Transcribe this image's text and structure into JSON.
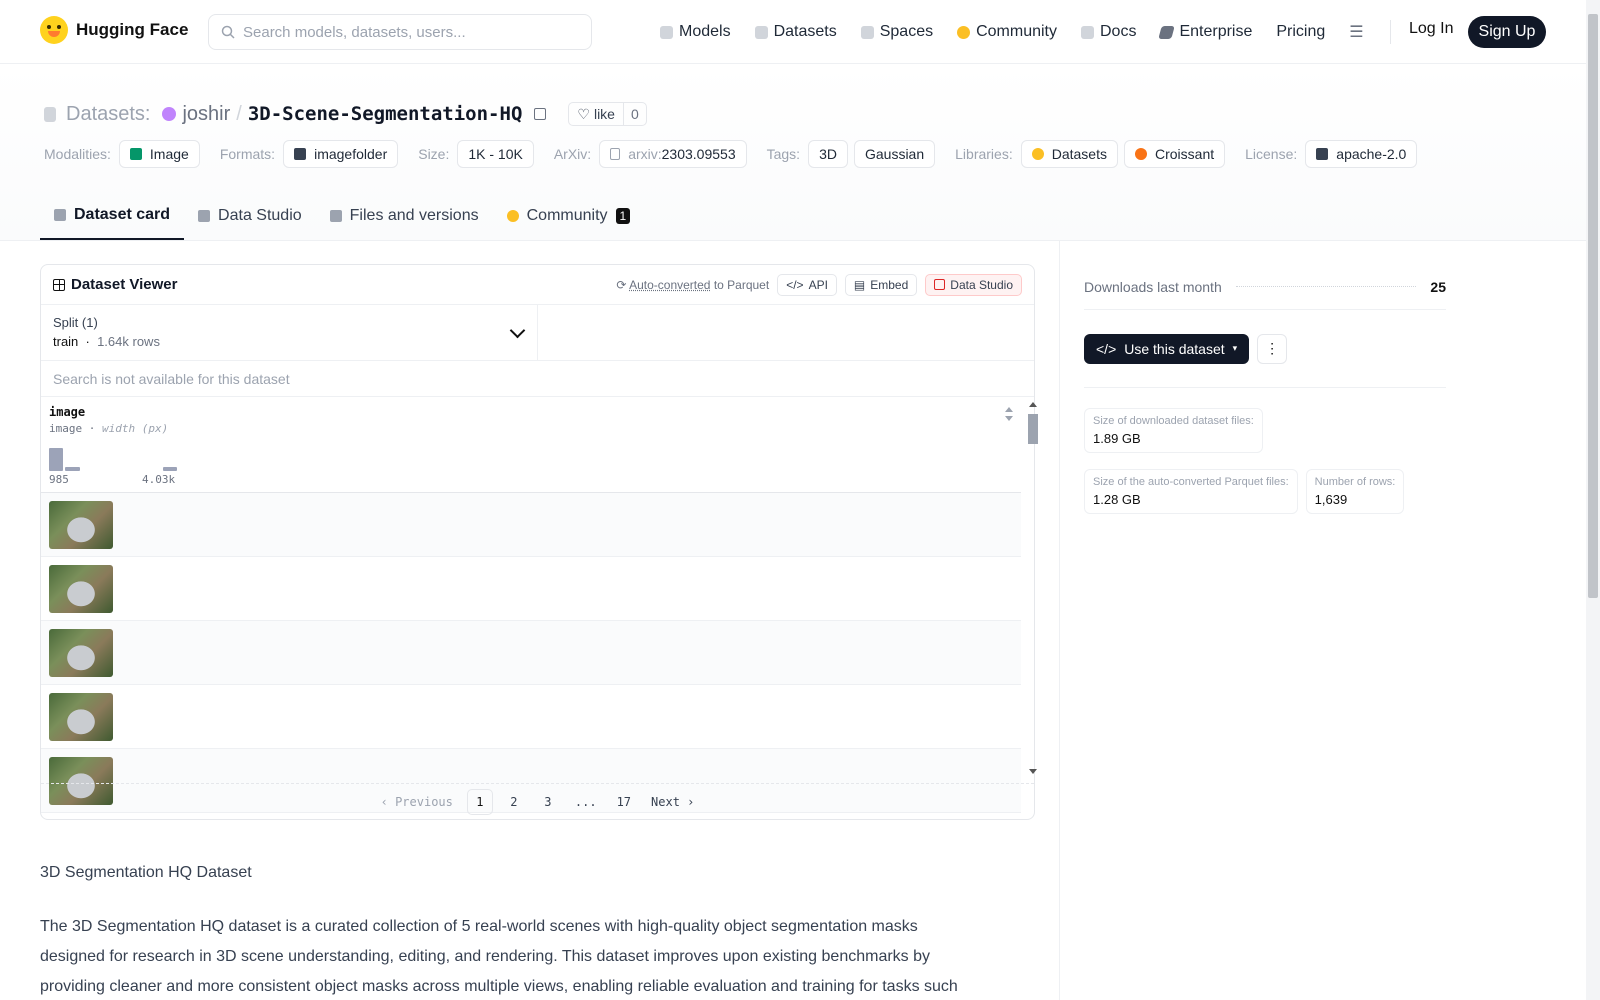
{
  "nav": {
    "brand": "Hugging Face",
    "search_placeholder": "Search models, datasets, users...",
    "links": [
      "Models",
      "Datasets",
      "Spaces",
      "Community",
      "Docs",
      "Enterprise",
      "Pricing"
    ],
    "login": "Log In",
    "signup": "Sign Up"
  },
  "header": {
    "type_label": "Datasets:",
    "user": "joshir",
    "slash": "/",
    "repo": "3D-Scene-Segmentation-HQ",
    "like_label": "like",
    "like_count": "0",
    "meta": {
      "modalities_label": "Modalities:",
      "modalities": "Image",
      "formats_label": "Formats:",
      "formats": "imagefolder",
      "size_label": "Size:",
      "size": "1K - 10K",
      "arxiv_label": "ArXiv:",
      "arxiv_prefix": "arxiv:",
      "arxiv_id": "2303.09553",
      "tags_label": "Tags:",
      "tags": [
        "3D",
        "Gaussian"
      ],
      "libraries_label": "Libraries:",
      "libraries": [
        "Datasets",
        "Croissant"
      ],
      "license_label": "License:",
      "license": "apache-2.0"
    },
    "tabs": [
      "Dataset card",
      "Data Studio",
      "Files and versions",
      "Community"
    ],
    "community_count": "1"
  },
  "viewer": {
    "title": "Dataset Viewer",
    "autoconv_link": "Auto-converted",
    "autoconv_rest": " to Parquet",
    "api": "API",
    "embed": "Embed",
    "studio": "Data Studio",
    "split_label": "Split (1)",
    "split_value": "train",
    "split_rows": "1.64k rows",
    "search_placeholder": "Search is not available for this dataset",
    "column_name": "image",
    "column_type": "image",
    "column_stat": "width (px)",
    "hist_min": "985",
    "hist_max": "4.03k",
    "histogram": [
      0.9,
      0.15,
      0.0,
      0.0,
      0.0,
      0.0,
      0.0,
      0.15
    ],
    "row_count_visible": 5,
    "pager": [
      "Previous",
      "1",
      "2",
      "3",
      "...",
      "17",
      "Next"
    ],
    "current_page": "1"
  },
  "card": {
    "heading": "3D Segmentation HQ Dataset",
    "paragraph": "The 3D Segmentation HQ dataset is a curated collection of 5 real-world scenes with high-quality object segmentation masks designed for research in 3D scene understanding, editing, and rendering. This dataset improves upon existing benchmarks by providing cleaner and more consistent object masks across multiple views, enabling reliable evaluation and training for tasks such"
  },
  "sidebar": {
    "downloads_label": "Downloads last month",
    "downloads": "25",
    "use_button": "Use this dataset",
    "stats": [
      {
        "label": "Size of downloaded dataset files:",
        "value": "1.89 GB"
      },
      {
        "label": "Size of the auto-converted Parquet files:",
        "value": "1.28 GB"
      },
      {
        "label": "Number of rows:",
        "value": "1,639"
      }
    ]
  }
}
